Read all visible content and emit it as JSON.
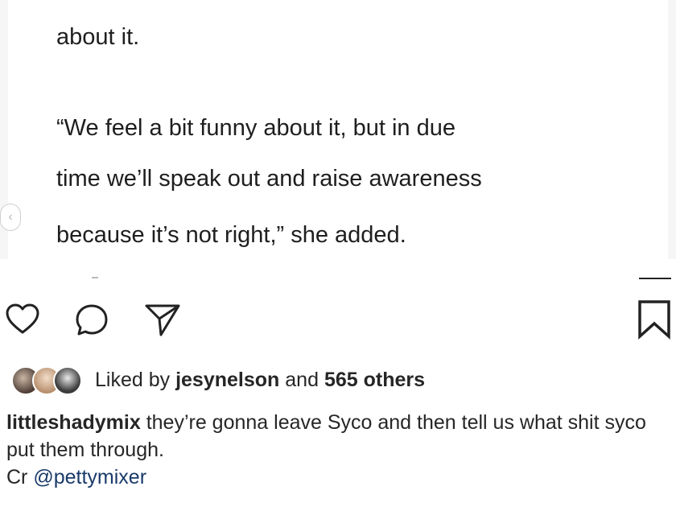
{
  "article": {
    "cut_line": "… … … … … … … …",
    "lines": [
      "about it.",
      "“We feel a bit funny about it, but in due",
      "time we’ll speak out and raise awareness",
      "because it’s not right,” she added."
    ]
  },
  "carousel": {
    "prev_glyph": "‹"
  },
  "actions": {
    "like_icon": "heart-icon",
    "comment_icon": "comment-icon",
    "share_icon": "paper-plane-icon",
    "save_icon": "bookmark-icon"
  },
  "likes": {
    "prefix": "Liked by",
    "user": "jesynelson",
    "middle": "and",
    "count": "565 others"
  },
  "caption": {
    "username": "littleshadymix",
    "text": "they’re gonna leave Syco and then tell us what shit syco put them through.",
    "credit_prefix": "Cr",
    "credit_mention": "@pettymixer"
  },
  "colors": {
    "mention": "#1a3a6a",
    "text": "#262626"
  }
}
